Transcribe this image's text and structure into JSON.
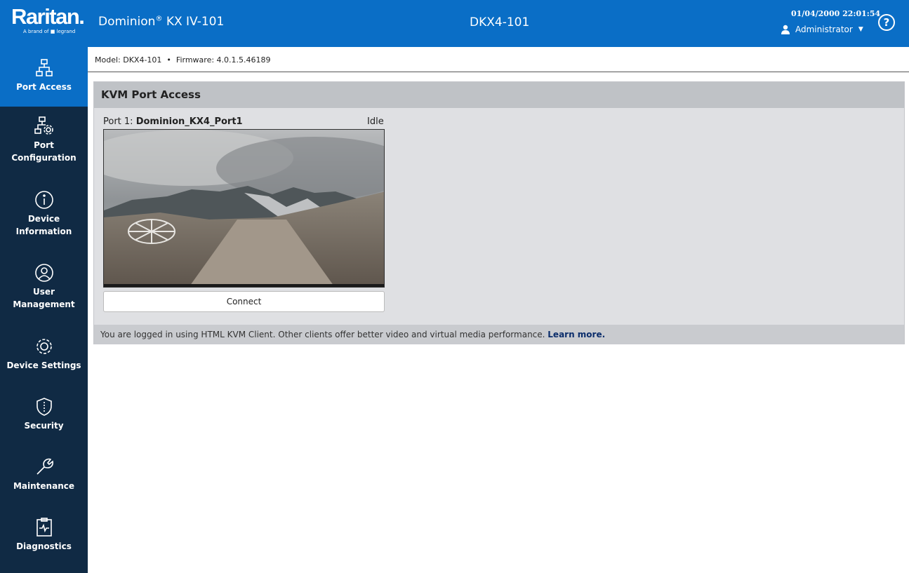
{
  "header": {
    "logo_text": "Raritan.",
    "logo_sub": "A brand of ■ legrand",
    "product_name": "Dominion",
    "product_reg": "®",
    "product_model": " KX IV-101",
    "hostname": "DKX4-101",
    "datetime": "01/04/2000 22:01:54",
    "user": "Administrator",
    "help_label": "?"
  },
  "sidebar": {
    "items": [
      {
        "label": "Port Access",
        "icon": "network-icon",
        "active": true
      },
      {
        "label": "Port\nConfiguration",
        "icon": "network-gear-icon"
      },
      {
        "label": "Device\nInformation",
        "icon": "info-icon"
      },
      {
        "label": "User\nManagement",
        "icon": "user-icon"
      },
      {
        "label": "Device Settings",
        "icon": "gear-icon"
      },
      {
        "label": "Security",
        "icon": "shield-icon"
      },
      {
        "label": "Maintenance",
        "icon": "wrench-icon"
      },
      {
        "label": "Diagnostics",
        "icon": "clipboard-pulse-icon"
      }
    ]
  },
  "subheader": {
    "model_label": "Model: DKX4-101",
    "separator": "•",
    "firmware_label": "Firmware: 4.0.1.5.46189"
  },
  "panel": {
    "title": "KVM Port Access",
    "port_prefix": "Port 1: ",
    "port_name": "Dominion_KX4_Port1",
    "port_status": "Idle",
    "connect_label": "Connect",
    "footer_text": "You are logged in using HTML KVM Client. Other clients offer better video and virtual media performance. ",
    "footer_link": "Learn more."
  },
  "colors": {
    "header_blue": "#0a6ec6",
    "sidebar_navy": "#102a44",
    "panel_bg": "#dfe0e3",
    "panel_title_bg": "#bfc2c6"
  }
}
